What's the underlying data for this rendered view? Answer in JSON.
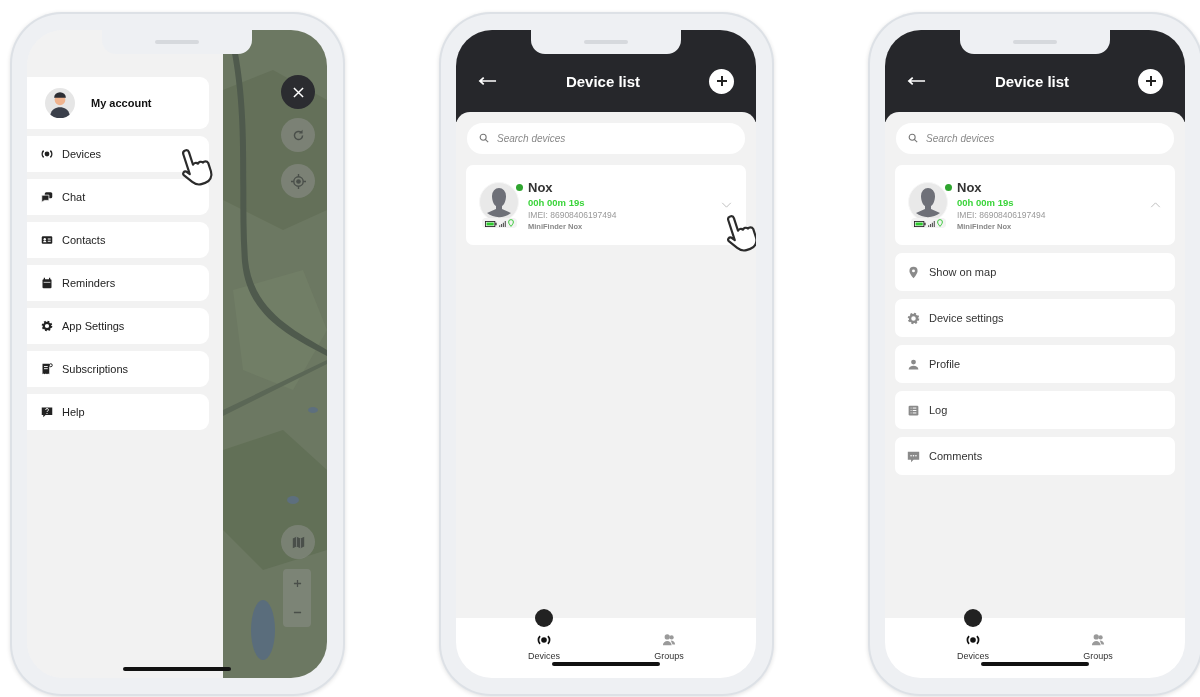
{
  "screens": [
    {
      "kind": "menu",
      "account": {
        "label": "My account"
      },
      "menu_items": [
        {
          "label": "Devices"
        },
        {
          "label": "Chat"
        },
        {
          "label": "Contacts"
        },
        {
          "label": "Reminders"
        },
        {
          "label": "App Settings"
        },
        {
          "label": "Subscriptions"
        },
        {
          "label": "Help"
        }
      ],
      "pointer": true
    },
    {
      "kind": "device_list",
      "title": "Device list",
      "search": {
        "placeholder": "Search devices"
      },
      "devices": [
        {
          "name": "Nox",
          "online": true,
          "time": "00h 00m 19s",
          "imei": "IMEI: 86908406197494",
          "model": "MiniFinder Nox",
          "expanded": false
        }
      ],
      "tabs": [
        {
          "label": "Devices",
          "selected": true
        },
        {
          "label": "Groups",
          "selected": false
        }
      ],
      "pointer": true
    },
    {
      "kind": "device_list",
      "title": "Device list",
      "search": {
        "placeholder": "Search devices"
      },
      "devices": [
        {
          "name": "Nox",
          "online": true,
          "time": "00h 00m 19s",
          "imei": "IMEI: 86908406197494",
          "model": "MiniFinder Nox",
          "expanded": true
        }
      ],
      "actions": [
        {
          "label": "Show on map"
        },
        {
          "label": "Device settings"
        },
        {
          "label": "Profile"
        },
        {
          "label": "Log"
        },
        {
          "label": "Comments"
        }
      ],
      "tabs": [
        {
          "label": "Devices",
          "selected": true
        },
        {
          "label": "Groups",
          "selected": false
        }
      ],
      "pointer": false
    }
  ]
}
